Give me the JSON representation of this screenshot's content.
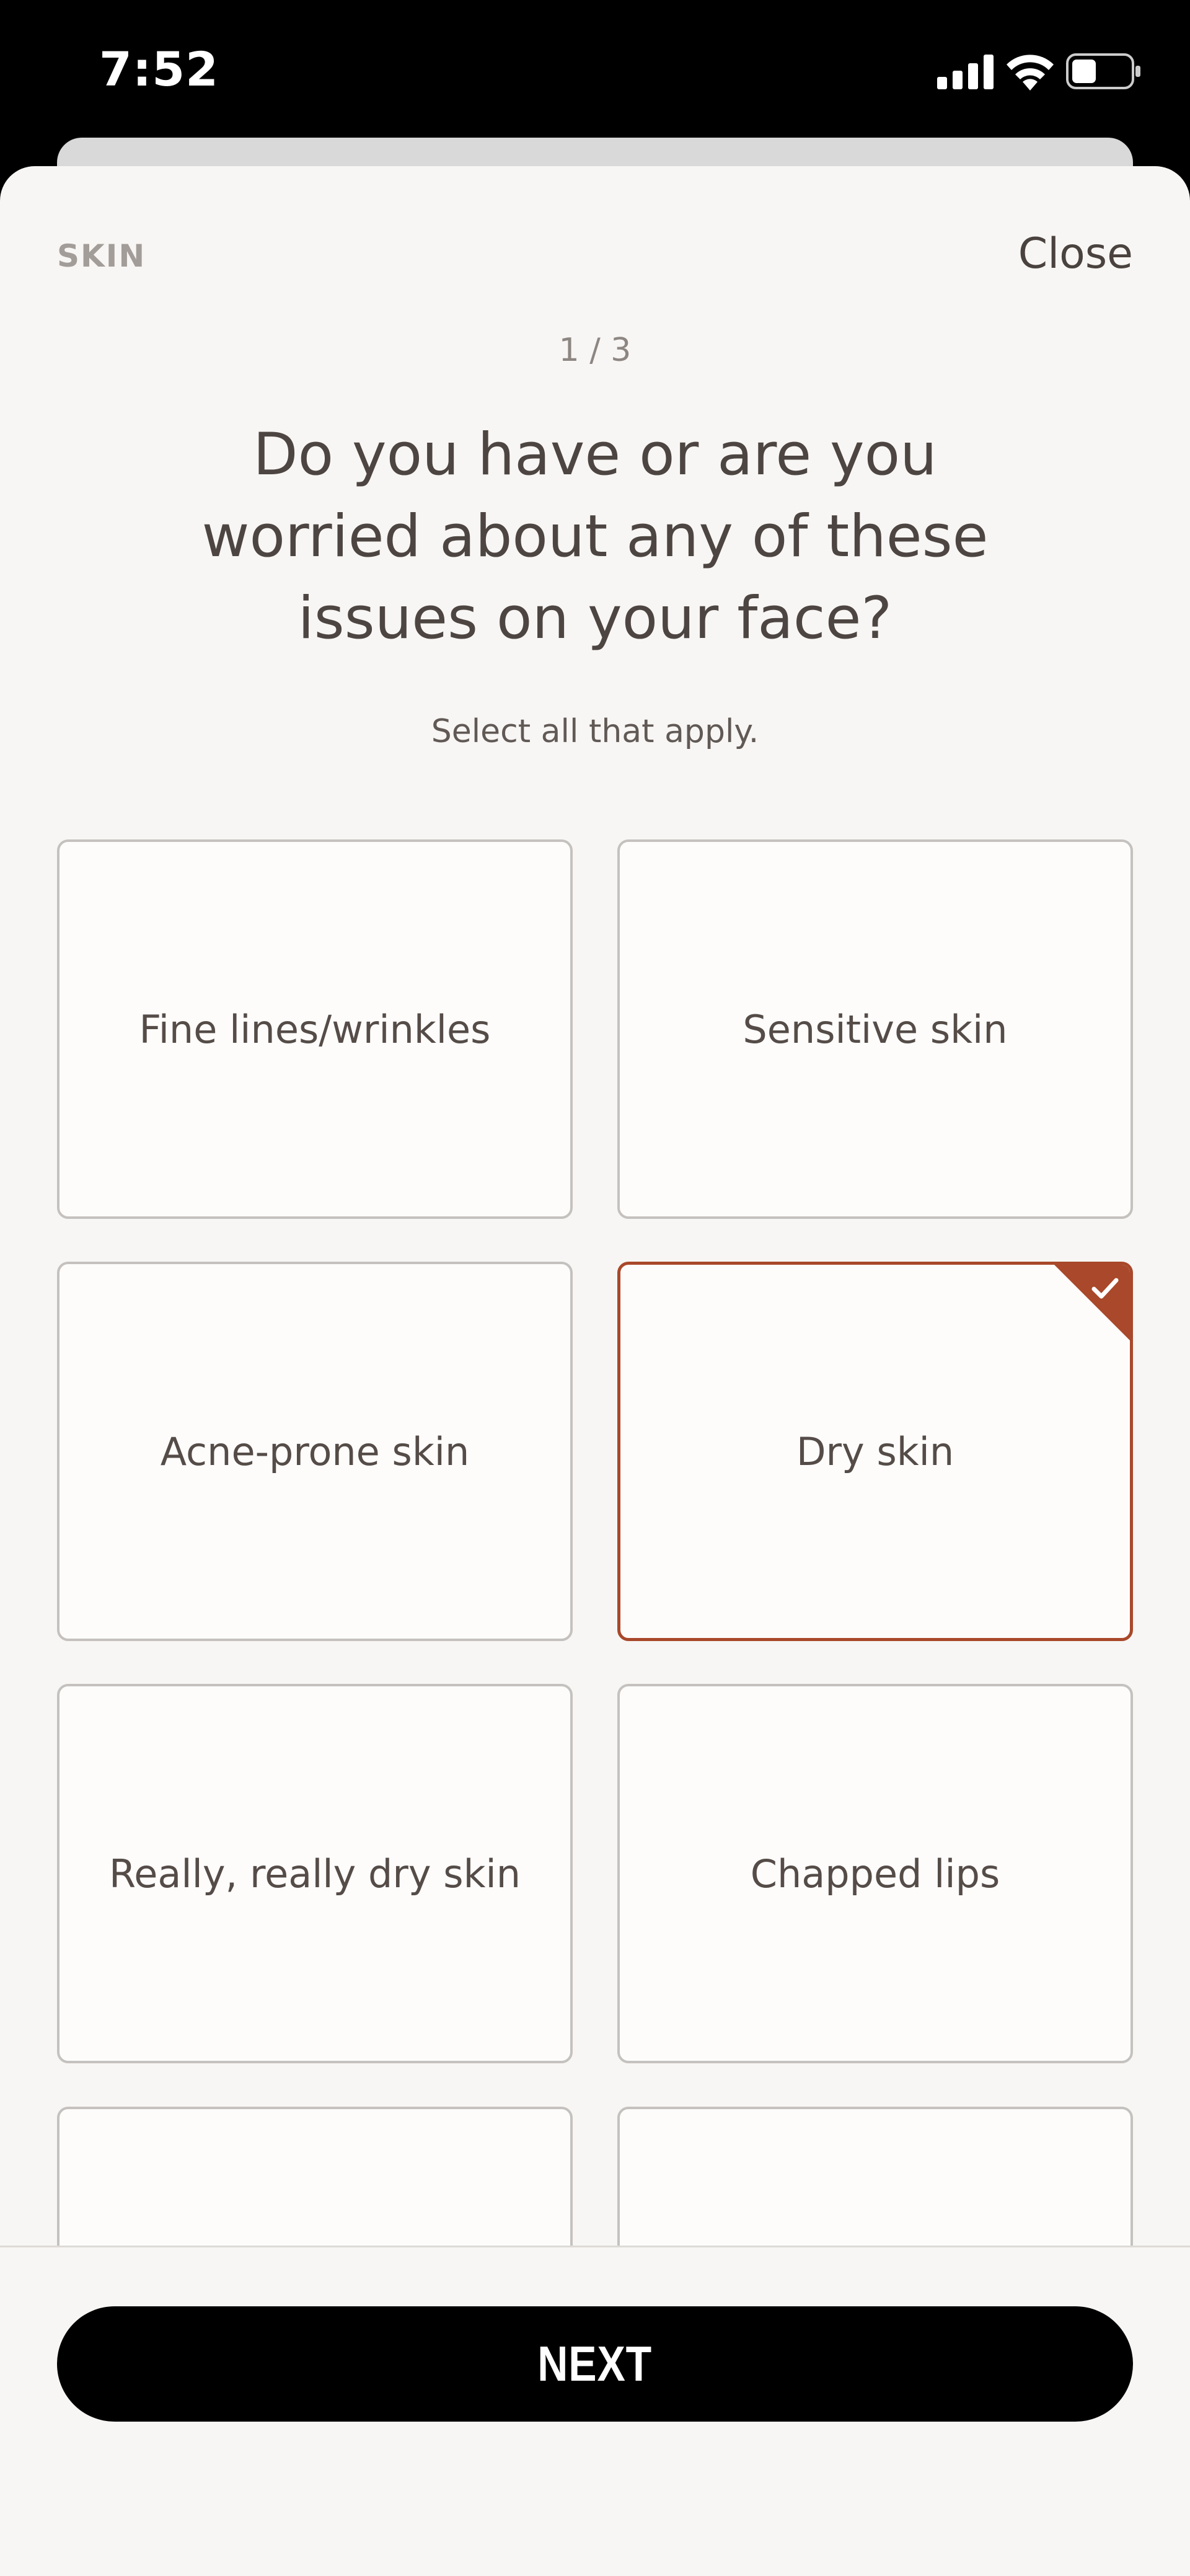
{
  "status_bar": {
    "time": "7:52",
    "signal_icon": "cellular-signal-icon",
    "wifi_icon": "wifi-icon",
    "battery_icon": "battery-icon"
  },
  "header": {
    "section": "SKIN",
    "close_label": "Close"
  },
  "progress": "1 / 3",
  "question": "Do you have or are you worried about any of these issues on your face?",
  "hint": "Select all that apply.",
  "options": [
    {
      "label": "Fine lines/wrinkles",
      "selected": false
    },
    {
      "label": "Sensitive skin",
      "selected": false
    },
    {
      "label": "Acne-prone skin",
      "selected": false
    },
    {
      "label": "Dry skin",
      "selected": true
    },
    {
      "label": "Really, really dry skin",
      "selected": false
    },
    {
      "label": "Chapped lips",
      "selected": false
    },
    {
      "label": "",
      "selected": false
    },
    {
      "label": "",
      "selected": false
    }
  ],
  "footer": {
    "next_label": "NEXT"
  },
  "colors": {
    "accent": "#a9482a",
    "background": "#f7f6f4",
    "text": "#4d4541"
  }
}
